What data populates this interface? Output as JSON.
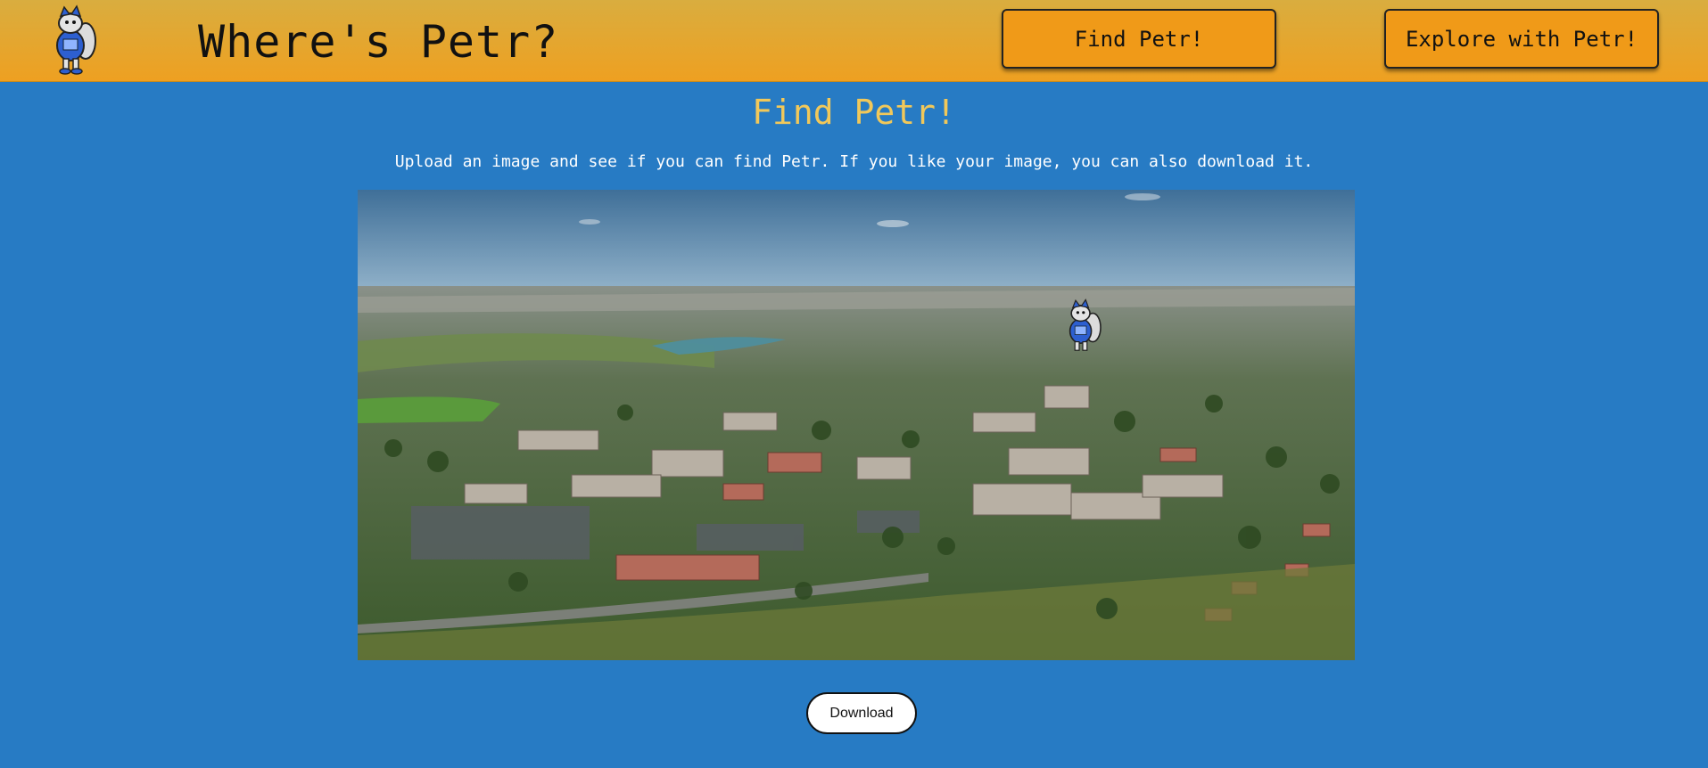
{
  "header": {
    "title": "Where's Petr?",
    "nav": {
      "find_label": "Find Petr!",
      "explore_label": "Explore with Petr!"
    },
    "logo_icon": "petr-mascot-icon"
  },
  "main": {
    "heading": "Find Petr!",
    "instructions": "Upload an image and see if you can find Petr. If you like your image, you can also download it.",
    "scene_icon": "aerial-campus-photo",
    "marker_icon": "petr-mascot-icon",
    "download_label": "Download"
  },
  "colors": {
    "header_top": "#d9ad3f",
    "header_bottom": "#eea021",
    "background": "#277bc4",
    "heading": "#f1c85a",
    "nav_button": "#f09a18"
  }
}
